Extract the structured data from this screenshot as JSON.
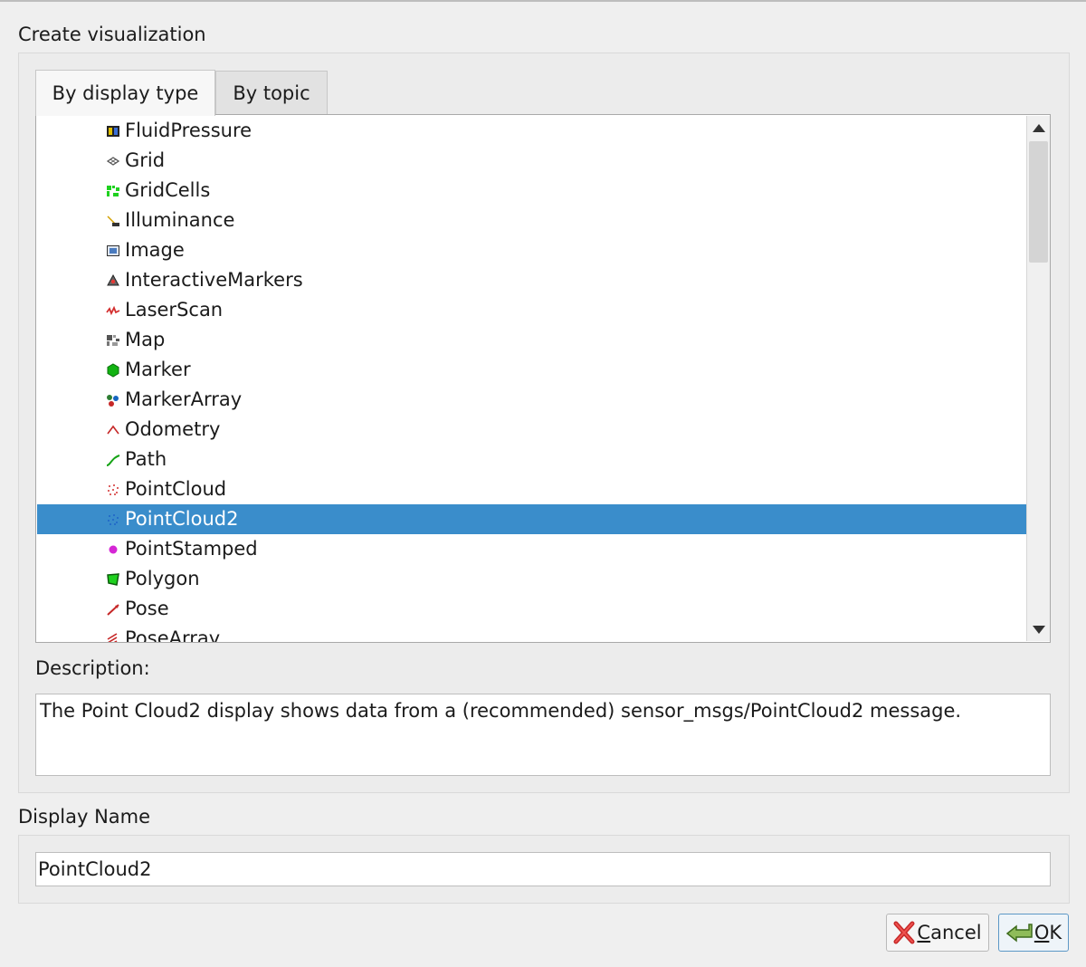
{
  "dialog": {
    "title": "Create visualization"
  },
  "tabs": [
    {
      "label": "By display type",
      "active": true
    },
    {
      "label": "By topic",
      "active": false
    }
  ],
  "display_types": [
    {
      "label": "FluidPressure",
      "icon": "fluid-pressure-icon"
    },
    {
      "label": "Grid",
      "icon": "grid-icon"
    },
    {
      "label": "GridCells",
      "icon": "grid-cells-icon"
    },
    {
      "label": "Illuminance",
      "icon": "illuminance-icon"
    },
    {
      "label": "Image",
      "icon": "image-icon"
    },
    {
      "label": "InteractiveMarkers",
      "icon": "interactive-markers-icon"
    },
    {
      "label": "LaserScan",
      "icon": "laser-scan-icon"
    },
    {
      "label": "Map",
      "icon": "map-icon"
    },
    {
      "label": "Marker",
      "icon": "marker-icon"
    },
    {
      "label": "MarkerArray",
      "icon": "marker-array-icon"
    },
    {
      "label": "Odometry",
      "icon": "odometry-icon"
    },
    {
      "label": "Path",
      "icon": "path-icon"
    },
    {
      "label": "PointCloud",
      "icon": "point-cloud-icon"
    },
    {
      "label": "PointCloud2",
      "icon": "point-cloud2-icon",
      "selected": true
    },
    {
      "label": "PointStamped",
      "icon": "point-stamped-icon"
    },
    {
      "label": "Polygon",
      "icon": "polygon-icon"
    },
    {
      "label": "Pose",
      "icon": "pose-icon"
    },
    {
      "label": "PoseArray",
      "icon": "pose-array-icon"
    }
  ],
  "description": {
    "label": "Description:",
    "text": "The Point Cloud2 display shows data from a (recommended) sensor_msgs/PointCloud2 message."
  },
  "display_name": {
    "label": "Display Name",
    "value": "PointCloud2"
  },
  "buttons": {
    "cancel": {
      "label": "Cancel",
      "mnemonic": "C",
      "rest": "ancel",
      "icon": "red-x-icon"
    },
    "ok": {
      "label": "OK",
      "mnemonic": "O",
      "rest": "K",
      "icon": "green-check-icon"
    }
  },
  "colors": {
    "selection": "#3a8dcb",
    "dialog_bg": "#efefef"
  }
}
